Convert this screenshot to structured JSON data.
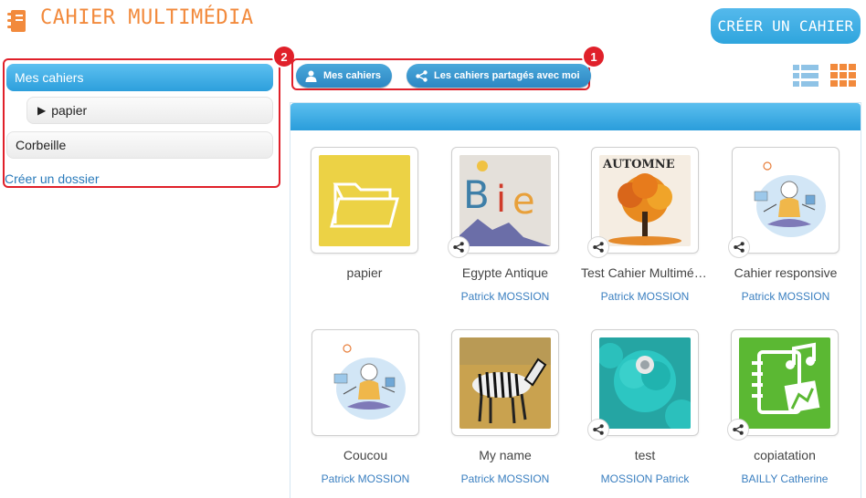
{
  "header": {
    "title": "CAHIER MULTIMÉDIA",
    "create_button": "CRÉER UN CAHIER",
    "brand_color": "#f28a3c",
    "accent_color": "#2fa5dd"
  },
  "sidebar": {
    "items": [
      {
        "label": "Mes cahiers",
        "state": "active"
      },
      {
        "label": "papier",
        "type": "folder"
      },
      {
        "label": "Corbeille"
      }
    ],
    "create_folder": "Créer un dossier",
    "badge": "2"
  },
  "tabs": {
    "my_notebooks": "Mes cahiers",
    "shared_notebooks": "Les cahiers partagés avec moi",
    "badge": "1"
  },
  "view_toggle": {
    "list_icon": "list-view-icon",
    "grid_icon": "grid-view-icon",
    "active": "grid"
  },
  "notebooks": [
    {
      "title": "papier",
      "author": "",
      "thumb": "folder",
      "shared": false
    },
    {
      "title": "Egypte Antique",
      "author": "Patrick MOSSION",
      "thumb": "letters",
      "shared": true
    },
    {
      "title": "Test Cahier Multimédia",
      "author": "Patrick MOSSION",
      "thumb": "autumn",
      "shared": true
    },
    {
      "title": "Cahier responsive",
      "author": "Patrick MOSSION",
      "thumb": "meditate",
      "shared": true
    },
    {
      "title": "Coucou",
      "author": "Patrick MOSSION",
      "thumb": "meditate",
      "shared": false
    },
    {
      "title": "My name",
      "author": "Patrick MOSSION",
      "thumb": "zebra",
      "shared": false
    },
    {
      "title": "test",
      "author": "MOSSION Patrick",
      "thumb": "cupcake",
      "shared": true
    },
    {
      "title": "copiatation",
      "author": "BAILLY Catherine",
      "thumb": "music",
      "shared": true
    }
  ]
}
